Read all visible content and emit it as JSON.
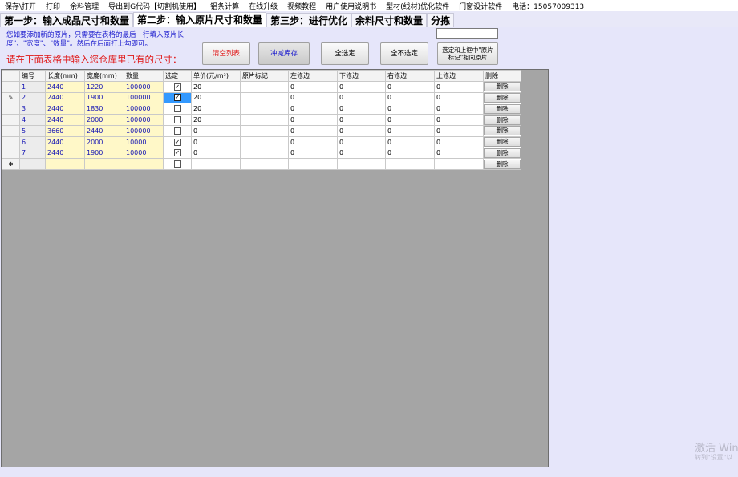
{
  "menu": [
    "保存\\打开",
    "打印",
    "余料管理",
    "导出到G代码【切割机使用】",
    "铝条计算",
    "在线升级",
    "视频教程",
    "用户使用说明书",
    "型材(线材)优化软件",
    "门窗设计软件",
    "电话：15057009313"
  ],
  "tabs": [
    "第一步：输入成品尺寸和数量",
    "第二步：输入原片尺寸和数量",
    "第三步：进行优化",
    "余料尺寸和数量",
    "分拣"
  ],
  "hint": "您如要添加新的原片，只需要在表格的最后一行填入原片长度\"、\"宽度\"、\"数量\"。然后在后面打上勾即可。",
  "hint2": "请在下面表格中输入您仓库里已有的尺寸：",
  "buttons": {
    "clear": "清空列表",
    "reduce": "冲减库存",
    "select_all": "全选定",
    "deselect_all": "全不选定",
    "select_mark": "选定和上框中\"原片标记\"相同原片"
  },
  "colors": {
    "clear_btn_text": "#e01818",
    "reduce_btn_text": "#1a1acd"
  },
  "table": {
    "headers": [
      "编号",
      "长度(mm)",
      "宽度(mm)",
      "数量",
      "选定",
      "单价(元/m²)",
      "原片标记",
      "左修边",
      "下修边",
      "右修边",
      "上修边",
      "删除"
    ],
    "rows": [
      {
        "indicator": "",
        "no": "1",
        "len": "2440",
        "wid": "1220",
        "qty": "100000",
        "checked": true,
        "selected": false,
        "price": "20",
        "mark": "",
        "l": "0",
        "b": "0",
        "r": "0",
        "t": "0",
        "del": "删除"
      },
      {
        "indicator": "✎",
        "no": "2",
        "len": "2440",
        "wid": "1900",
        "qty": "100000",
        "checked": true,
        "selected": true,
        "price": "20",
        "mark": "",
        "l": "0",
        "b": "0",
        "r": "0",
        "t": "0",
        "del": "删除"
      },
      {
        "indicator": "",
        "no": "3",
        "len": "2440",
        "wid": "1830",
        "qty": "100000",
        "checked": false,
        "selected": false,
        "price": "20",
        "mark": "",
        "l": "0",
        "b": "0",
        "r": "0",
        "t": "0",
        "del": "删除"
      },
      {
        "indicator": "",
        "no": "4",
        "len": "2440",
        "wid": "2000",
        "qty": "100000",
        "checked": false,
        "selected": false,
        "price": "20",
        "mark": "",
        "l": "0",
        "b": "0",
        "r": "0",
        "t": "0",
        "del": "删除"
      },
      {
        "indicator": "",
        "no": "5",
        "len": "3660",
        "wid": "2440",
        "qty": "100000",
        "checked": false,
        "selected": false,
        "price": "0",
        "mark": "",
        "l": "0",
        "b": "0",
        "r": "0",
        "t": "0",
        "del": "删除"
      },
      {
        "indicator": "",
        "no": "6",
        "len": "2440",
        "wid": "2000",
        "qty": "10000",
        "checked": true,
        "selected": false,
        "price": "0",
        "mark": "",
        "l": "0",
        "b": "0",
        "r": "0",
        "t": "0",
        "del": "删除"
      },
      {
        "indicator": "",
        "no": "7",
        "len": "2440",
        "wid": "1900",
        "qty": "10000",
        "checked": true,
        "selected": false,
        "price": "0",
        "mark": "",
        "l": "0",
        "b": "0",
        "r": "0",
        "t": "0",
        "del": "删除"
      },
      {
        "indicator": "✱",
        "no": "",
        "len": "",
        "wid": "",
        "qty": "",
        "checked": false,
        "selected": false,
        "price": "",
        "mark": "",
        "l": "",
        "b": "",
        "r": "",
        "t": "",
        "del": "删除"
      }
    ]
  },
  "watermark": {
    "line1": "激活 Wind",
    "line2": "转到\"设置\"以"
  }
}
